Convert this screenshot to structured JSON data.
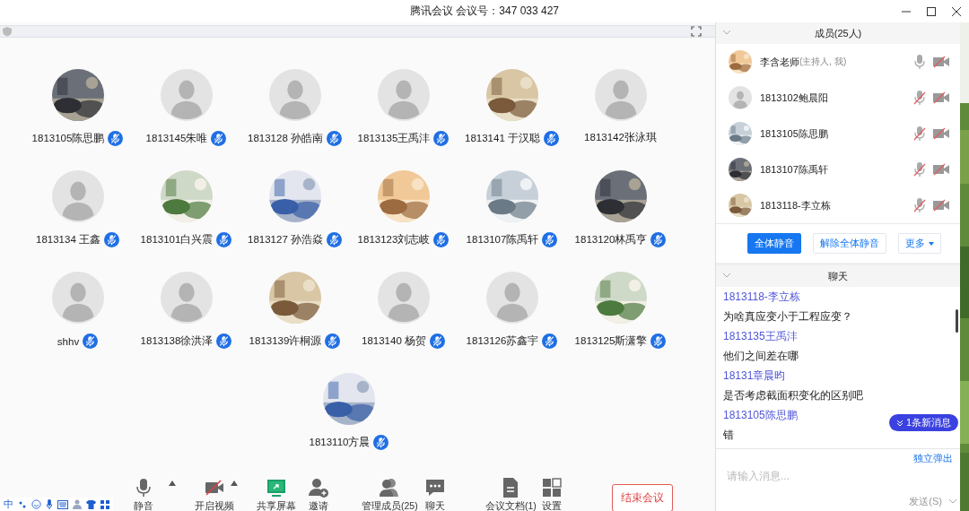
{
  "window": {
    "title": "腾讯会议 会议号：347 033 427"
  },
  "participants": [
    {
      "name": "1813105陈思鹏",
      "has_photo": true,
      "mic_badge": true
    },
    {
      "name": "1813145朱唯",
      "has_photo": false,
      "mic_badge": true
    },
    {
      "name": "1813128 孙皓南",
      "has_photo": false,
      "mic_badge": true
    },
    {
      "name": "1813135王禹沣",
      "has_photo": false,
      "mic_badge": true
    },
    {
      "name": "1813141 于汉聪",
      "has_photo": true,
      "mic_badge": true
    },
    {
      "name": "1813142张泳琪",
      "has_photo": false,
      "mic_badge": false
    },
    {
      "name": "1813134 王鑫",
      "has_photo": false,
      "mic_badge": true
    },
    {
      "name": "1813101白兴震",
      "has_photo": true,
      "mic_badge": true
    },
    {
      "name": "1813127 孙浩焱",
      "has_photo": true,
      "mic_badge": true
    },
    {
      "name": "1813123刘志岐",
      "has_photo": true,
      "mic_badge": true
    },
    {
      "name": "1813107陈禹轩",
      "has_photo": true,
      "mic_badge": true
    },
    {
      "name": "1813120林禹亨",
      "has_photo": true,
      "mic_badge": true
    },
    {
      "name": "shhv",
      "has_photo": false,
      "mic_badge": true
    },
    {
      "name": "1813138徐洪泽",
      "has_photo": false,
      "mic_badge": true
    },
    {
      "name": "1813139许桐源",
      "has_photo": true,
      "mic_badge": true
    },
    {
      "name": "1813140 杨贺",
      "has_photo": false,
      "mic_badge": true
    },
    {
      "name": "1813126苏鑫宇",
      "has_photo": false,
      "mic_badge": true
    },
    {
      "name": "1813125斯潇擎",
      "has_photo": true,
      "mic_badge": true
    },
    {
      "name": "1813110方晨",
      "has_photo": true,
      "mic_badge": true
    }
  ],
  "toolbar": {
    "items": [
      {
        "kind": "mic",
        "label": "静音",
        "menu": true
      },
      {
        "kind": "video",
        "label": "开启视频",
        "menu": true
      },
      {
        "kind": "share",
        "label": "共享屏幕",
        "menu": false
      },
      {
        "kind": "invite",
        "label": "邀请",
        "menu": false
      },
      {
        "kind": "members",
        "label": "管理成员(25)",
        "menu": false
      },
      {
        "kind": "chat",
        "label": "聊天",
        "menu": false
      },
      {
        "kind": "docs",
        "label": "会议文档(1)",
        "menu": false
      },
      {
        "kind": "settings",
        "label": "设置",
        "menu": false
      }
    ],
    "end_button": "结束会议"
  },
  "ime_bar": {
    "label": "中"
  },
  "members": {
    "title": "成员(25人)",
    "items": [
      {
        "name": "李含老师",
        "note": "(主持人, 我)",
        "has_photo": true,
        "mic_muted": false,
        "video_off": true
      },
      {
        "name": "1813102鲍晨阳",
        "has_photo": false,
        "mic_muted": true,
        "video_off": true
      },
      {
        "name": "1813105陈思鹏",
        "has_photo": true,
        "mic_muted": true,
        "video_off": true
      },
      {
        "name": "1813107陈禹轩",
        "has_photo": true,
        "mic_muted": true,
        "video_off": true
      },
      {
        "name": "1813118-李立栋",
        "has_photo": true,
        "mic_muted": true,
        "video_off": true
      }
    ],
    "buttons": [
      {
        "label": "全体静音",
        "primary": true
      },
      {
        "label": "解除全体静音",
        "primary": false
      }
    ],
    "more": "更多"
  },
  "chat": {
    "title": "聊天",
    "messages": [
      {
        "sender": "1813118-李立栋",
        "text": "为啥真应变小于工程应变？"
      },
      {
        "sender": "1813135王禹沣",
        "text": "他们之间差在哪"
      },
      {
        "sender": "18131章晨昀",
        "text": "是否考虑截面积变化的区别吧"
      },
      {
        "sender": "1813105陈思鹏",
        "text": "错"
      }
    ],
    "new_messages": "1条新消息",
    "popout": "独立弹出",
    "placeholder": "请输入消息...",
    "send": "发送(S)"
  }
}
